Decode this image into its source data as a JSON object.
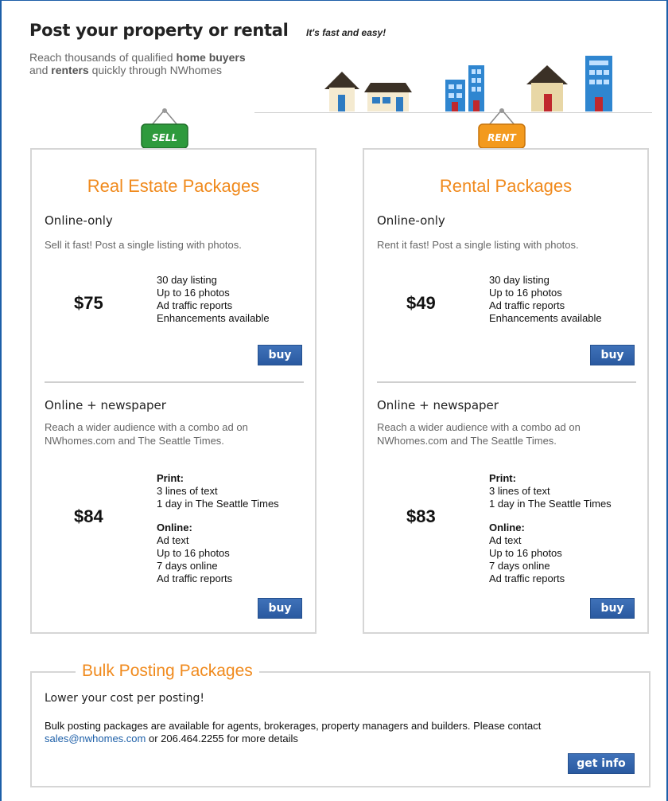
{
  "header": {
    "headline": "Post your property or rental",
    "tagline": "It's fast and easy!",
    "intro_pre": "Reach thousands of qualified ",
    "intro_b1": "home buyers",
    "intro_mid": "and ",
    "intro_b2": "renters",
    "intro_post": " quickly through NWhomes"
  },
  "real_estate": {
    "sign": "SELL",
    "title": "Real Estate Packages",
    "online": {
      "title": "Online-only",
      "desc": "Sell it fast! Post a single listing with photos.",
      "price": "$75",
      "features": [
        "30 day listing",
        "Up to 16 photos",
        "Ad traffic reports",
        "Enhancements available"
      ],
      "buy": "buy"
    },
    "combo": {
      "title": "Online + newspaper",
      "desc": "Reach a wider audience with a combo ad on NWhomes.com and The Seattle Times.",
      "price": "$84",
      "print_head": "Print:",
      "print": [
        "3 lines of text",
        "1 day in The Seattle Times"
      ],
      "online_head": "Online:",
      "online": [
        "Ad text",
        "Up to 16 photos",
        "7 days online",
        "Ad traffic reports"
      ],
      "buy": "buy"
    }
  },
  "rental": {
    "sign": "RENT",
    "title": "Rental Packages",
    "online": {
      "title": "Online-only",
      "desc": "Rent it fast! Post a single listing with photos.",
      "price": "$49",
      "features": [
        "30 day listing",
        "Up to 16 photos",
        "Ad traffic reports",
        "Enhancements available"
      ],
      "buy": "buy"
    },
    "combo": {
      "title": "Online + newspaper",
      "desc": "Reach a wider audience with a combo ad on NWhomes.com and The Seattle Times.",
      "price": "$83",
      "print_head": "Print:",
      "print": [
        "3 lines of text",
        "1 day in The Seattle Times"
      ],
      "online_head": "Online:",
      "online": [
        "Ad text",
        "Up to 16 photos",
        "7 days online",
        "Ad traffic reports"
      ],
      "buy": "buy"
    }
  },
  "bulk": {
    "title": "Bulk Posting Packages",
    "subtitle": "Lower your cost per posting!",
    "text": "Bulk posting packages are available for agents, brokerages, property managers and builders. Please contact",
    "email": "sales@nwhomes.com",
    "text_after": " or 206.464.2255 for more details",
    "button": "get info"
  },
  "colors": {
    "accent_orange": "#f08a1d",
    "button_blue": "#2a5aa0",
    "frame_blue": "#1d5fa8",
    "sign_green": "#2e9a3c",
    "sign_orange": "#f39a1e"
  }
}
